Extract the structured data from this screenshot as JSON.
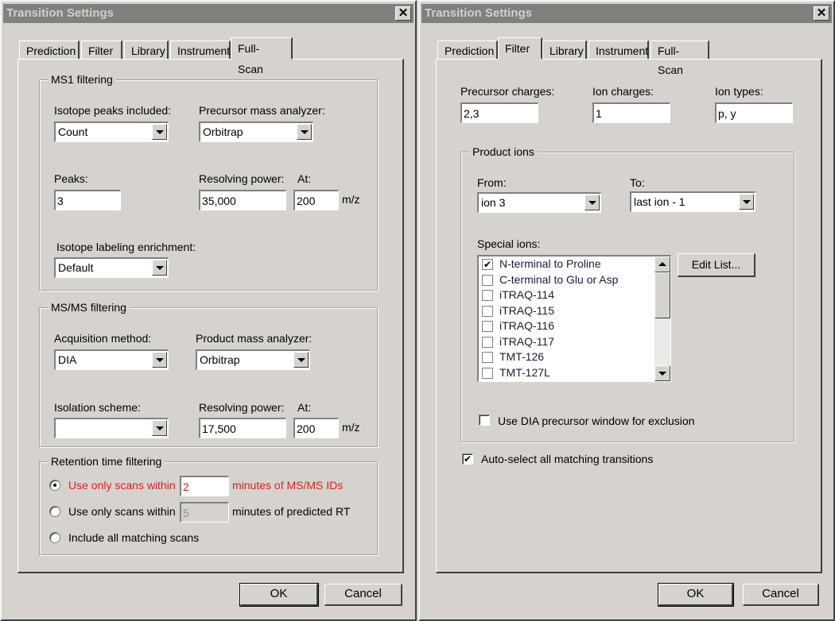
{
  "left_dialog": {
    "title": "Transition Settings",
    "close_label": "✕",
    "tabs": [
      {
        "label": "Prediction",
        "active": false
      },
      {
        "label": "Filter",
        "active": false
      },
      {
        "label": "Library",
        "active": false
      },
      {
        "label": "Instrument",
        "active": false
      },
      {
        "label": "Full-Scan",
        "active": true
      }
    ],
    "ms1": {
      "group_title": "MS1 filtering",
      "isotope_peaks_label": "Isotope peaks included:",
      "isotope_peaks_value": "Count",
      "precursor_analyzer_label": "Precursor mass analyzer:",
      "precursor_analyzer_value": "Orbitrap",
      "peaks_label": "Peaks:",
      "peaks_value": "3",
      "resolving_power_label": "Resolving power:",
      "resolving_power_value": "35,000",
      "at_label": "At:",
      "at_value": "200",
      "mz_label": "m/z",
      "enrichment_label": "Isotope labeling enrichment:",
      "enrichment_value": "Default"
    },
    "msms": {
      "group_title": "MS/MS filtering",
      "acquisition_label": "Acquisition method:",
      "acquisition_value": "DIA",
      "product_analyzer_label": "Product mass analyzer:",
      "product_analyzer_value": "Orbitrap",
      "isolation_label": "Isolation scheme:",
      "isolation_value": "",
      "resolving_power_label": "Resolving power:",
      "resolving_power_value": "17,500",
      "at_label": "At:",
      "at_value": "200",
      "mz_label": "m/z"
    },
    "rt": {
      "group_title": "Retention time filtering",
      "option1_prefix": "Use only scans within",
      "option1_value": "2",
      "option1_suffix": "minutes of MS/MS IDs",
      "option2_prefix": "Use only scans within",
      "option2_value": "5",
      "option2_suffix": "minutes of predicted RT",
      "option3_label": "Include all matching scans",
      "selected": 1
    },
    "ok_label": "OK",
    "cancel_label": "Cancel"
  },
  "right_dialog": {
    "title": "Transition Settings",
    "close_label": "✕",
    "tabs": [
      {
        "label": "Prediction",
        "active": false
      },
      {
        "label": "Filter",
        "active": true
      },
      {
        "label": "Library",
        "active": false
      },
      {
        "label": "Instrument",
        "active": false
      },
      {
        "label": "Full-Scan",
        "active": false
      }
    ],
    "precursor_charges_label": "Precursor charges:",
    "precursor_charges_value": "2,3",
    "ion_charges_label": "Ion charges:",
    "ion_charges_value": "1",
    "ion_types_label": "Ion types:",
    "ion_types_value": "p, y",
    "product_ions": {
      "group_title": "Product ions",
      "from_label": "From:",
      "from_value": "ion 3",
      "to_label": "To:",
      "to_value": "last ion - 1",
      "special_ions_label": "Special ions:",
      "special_ions": [
        {
          "label": "N-terminal to Proline",
          "checked": true
        },
        {
          "label": "C-terminal to Glu or Asp",
          "checked": false
        },
        {
          "label": "iTRAQ-114",
          "checked": false
        },
        {
          "label": "iTRAQ-115",
          "checked": false
        },
        {
          "label": "iTRAQ-116",
          "checked": false
        },
        {
          "label": "iTRAQ-117",
          "checked": false
        },
        {
          "label": "TMT-126",
          "checked": false
        },
        {
          "label": "TMT-127L",
          "checked": false
        }
      ],
      "edit_list_label": "Edit List...",
      "dia_exclusion_label": "Use DIA precursor window for exclusion",
      "dia_exclusion_checked": false
    },
    "auto_select_label": "Auto-select all matching transitions",
    "auto_select_checked": true,
    "ok_label": "OK",
    "cancel_label": "Cancel"
  }
}
